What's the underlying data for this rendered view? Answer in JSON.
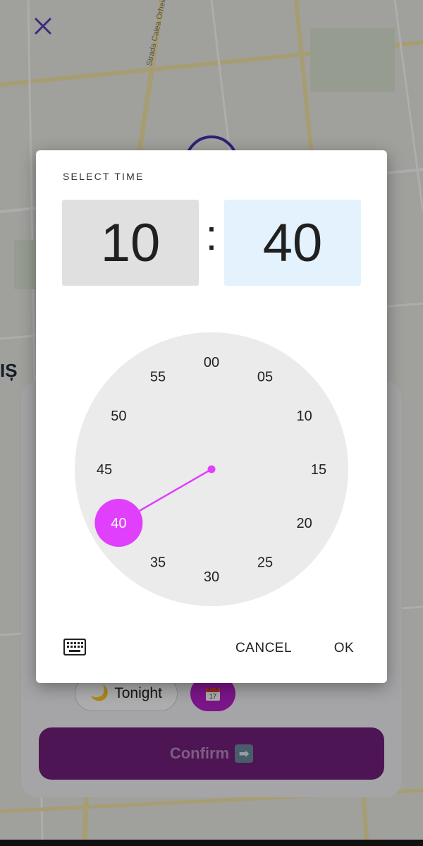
{
  "map": {
    "street_label": "Strada Calea Orheiului",
    "side_text": "IȘ"
  },
  "sheet": {
    "tonight_emoji": "🌙",
    "tonight_label": "Tonight",
    "calendar_day": "17",
    "confirm_label": "Confirm",
    "confirm_arrow": "➡"
  },
  "dialog": {
    "title": "SELECT TIME",
    "hour": "10",
    "separator": ":",
    "minute": "40",
    "cancel_label": "CANCEL",
    "ok_label": "OK"
  },
  "clock": {
    "labels": [
      "00",
      "05",
      "10",
      "15",
      "20",
      "25",
      "30",
      "35",
      "40",
      "45",
      "50",
      "55"
    ],
    "selected_label": "40",
    "selected_index": 8
  },
  "colors": {
    "accent": "#e040fb",
    "face": "#ebebeb",
    "hour_box": "#e0e0e0",
    "minute_box": "#e3f2fd",
    "confirm_bg": "#73207e",
    "calendar_chip": "#b51fc9"
  },
  "icons": {
    "close": "close-icon",
    "keyboard": "keyboard-icon",
    "calendar": "calendar-icon",
    "moon": "moon-icon",
    "arrow": "arrow-right-icon"
  }
}
